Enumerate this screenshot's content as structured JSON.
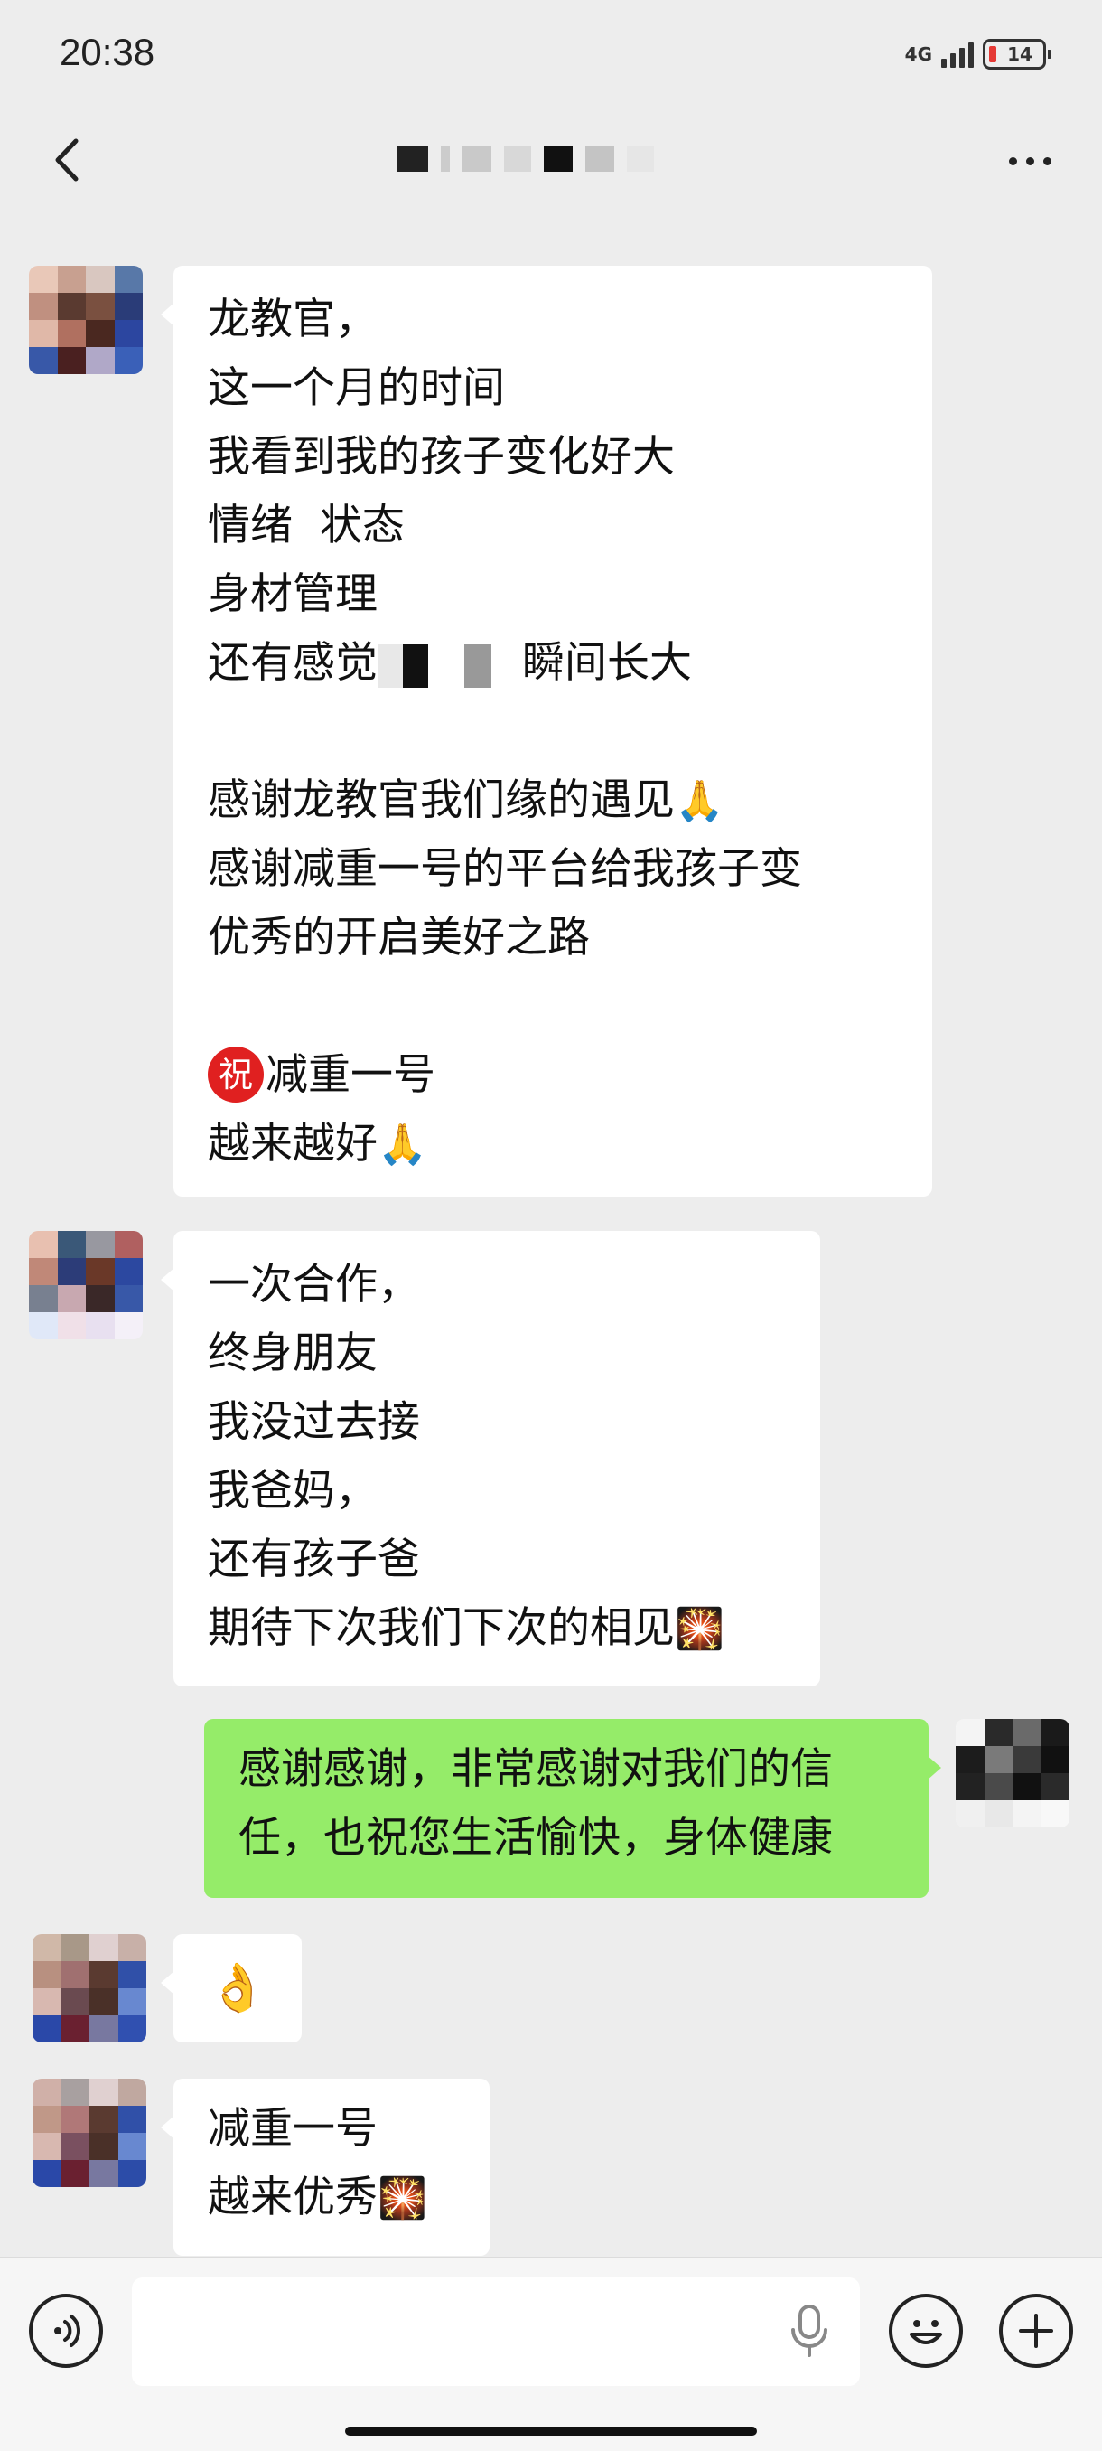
{
  "status_bar": {
    "time": "20:38",
    "network": "4G",
    "battery": "14"
  },
  "nav": {
    "back_icon": "chevron-left-icon",
    "more_icon": "more-dots-icon"
  },
  "messages": [
    {
      "side": "left",
      "lines": [
        "龙教官，",
        "这一个月的时间",
        "我看到我的孩子变化好大",
        "情绪  状态",
        "身材管理",
        "还有感觉",
        "瞬间长大"
      ],
      "lines_b": [
        "感谢龙教官我们缘的遇见",
        "感谢减重一号的平台给我孩子变",
        "优秀的开启美好之路"
      ],
      "badge": "祝",
      "lines_c": [
        "减重一号",
        "越来越好"
      ],
      "emoji_pray": "🙏"
    },
    {
      "side": "left",
      "lines": [
        "一次合作，",
        "终身朋友",
        "我没过去接",
        "我爸妈，",
        "还有孩子爸",
        "期待下次我们下次的相见"
      ],
      "emoji_fireworks": "🎇"
    },
    {
      "side": "right",
      "lines": [
        "感谢感谢，非常感谢对我们的信",
        "任，也祝您生活愉快，身体健康"
      ]
    },
    {
      "side": "left",
      "emoji": "👌"
    },
    {
      "side": "left",
      "lines": [
        "减重一号",
        "越来优秀"
      ],
      "emoji_fireworks": "🎇"
    }
  ],
  "input": {
    "value": "",
    "placeholder": ""
  },
  "colors": {
    "background": "#ededed",
    "bubble_left": "#ffffff",
    "bubble_right": "#95ec69"
  }
}
